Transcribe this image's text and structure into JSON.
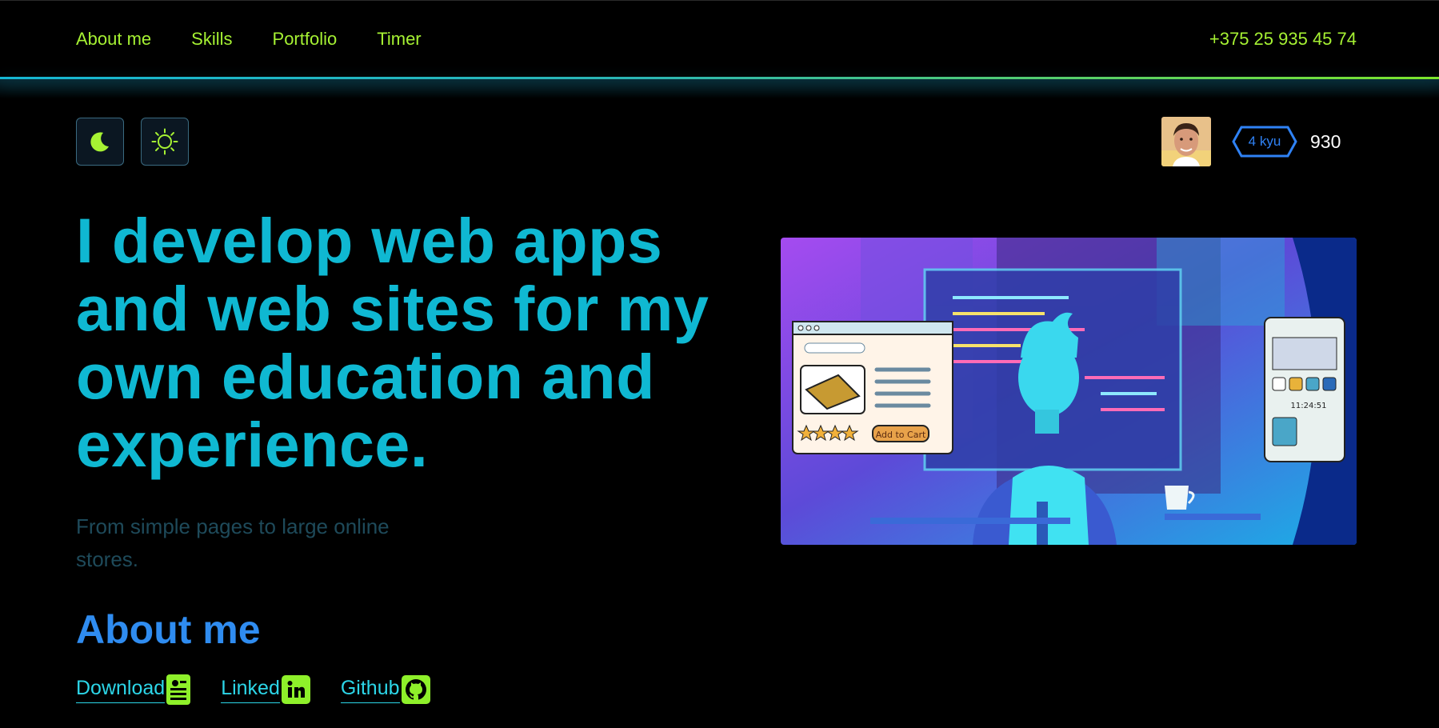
{
  "nav": {
    "items": [
      {
        "label": "About me"
      },
      {
        "label": "Skills"
      },
      {
        "label": "Portfolio"
      },
      {
        "label": "Timer"
      }
    ],
    "phone": "+375 25 935 45 74"
  },
  "theme": {
    "dark_icon": "moon-icon",
    "light_icon": "sun-icon"
  },
  "profile": {
    "rank": "4 kyu",
    "score": "930",
    "avatar_icon": "avatar-photo"
  },
  "hero": {
    "headline": "I develop web apps and web sites for my own education and experience.",
    "subtitle": "From simple pages to large online stores.",
    "image_icon": "developer-illustration",
    "image_button": "Add to Cart",
    "image_time": "11:24:51"
  },
  "about": {
    "title": "About me",
    "links": [
      {
        "label": "Download",
        "icon": "resume-icon"
      },
      {
        "label": "Linked",
        "icon": "linkedin-icon"
      },
      {
        "label": "Github",
        "icon": "github-icon"
      }
    ]
  },
  "colors": {
    "accent_green": "#a6f233",
    "headline_cyan": "#0fb8d2",
    "about_blue": "#2f8cf0",
    "link_cyan": "#2cd6e8",
    "background": "#000000"
  }
}
